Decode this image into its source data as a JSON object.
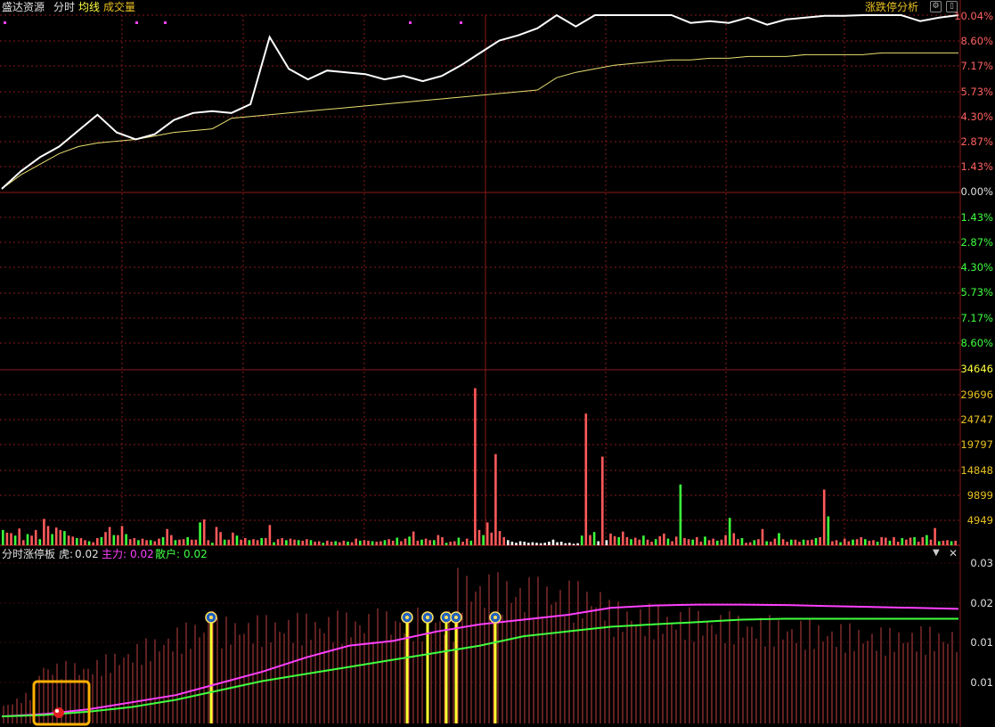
{
  "header": {
    "stock_name": "盛达资源",
    "mode": "分时",
    "avg_line_label": "均线",
    "volume_label": "成交量",
    "analysis_button": "涨跌停分析"
  },
  "indicator_header": {
    "name": "分时涨停板",
    "tiger_label": "虎:",
    "tiger_value": "0.02",
    "main_label": "主力:",
    "main_value": "0.02",
    "retail_label": "散户:",
    "retail_value": "0.02"
  },
  "price_axis": {
    "up": [
      "10.04%",
      "8.60%",
      "7.17%",
      "5.73%",
      "4.30%",
      "2.87%",
      "1.43%"
    ],
    "zero": "0.00%",
    "down": [
      "1.43%",
      "2.87%",
      "4.30%",
      "5.73%",
      "7.17%",
      "8.60%"
    ]
  },
  "volume_axis": [
    "34646",
    "29696",
    "24747",
    "19797",
    "14848",
    "9899",
    "4949"
  ],
  "indicator_axis": [
    "0.03",
    "0.02",
    "0.01",
    "0.01"
  ],
  "colors": {
    "up": "#ff5a5a",
    "down": "#3cff3c",
    "price_line": "#ffffff",
    "avg_line": "#e8e070",
    "grid": "#8a1a1a",
    "main_line": "#ff40ff",
    "retail_line": "#40ff40",
    "signal_bar": "#ffff30",
    "highlight_box": "#ffb000"
  },
  "icons": {
    "settings": "gear-icon",
    "window": "window-icon",
    "dropdown": "chevron-down-icon",
    "close": "close-icon",
    "signal_marker": "coin-icon",
    "buy_marker": "ball-icon"
  },
  "chart_data": [
    {
      "type": "line",
      "series": [
        {
          "values": [
            0.2,
            1.2,
            2.0,
            2.6,
            3.5,
            4.4,
            3.4,
            3.0,
            3.3,
            4.1,
            4.5,
            4.6,
            4.5,
            5.0,
            8.8,
            7.0,
            6.4,
            6.9,
            6.8,
            6.7,
            6.4,
            6.6,
            6.3,
            6.6,
            7.2,
            7.9,
            8.6,
            8.9,
            9.3,
            10.04,
            9.4,
            10.04,
            10.04,
            10.04,
            10.04,
            10.04,
            9.6,
            9.7,
            9.6,
            9.9,
            9.5,
            9.8,
            9.9,
            10.0,
            10.0,
            10.04,
            10.04,
            10.04,
            9.7,
            9.9,
            10.04
          ]
        },
        {
          "values": [
            0.2,
            1.0,
            1.6,
            2.2,
            2.6,
            2.8,
            2.9,
            3.0,
            3.2,
            3.4,
            3.5,
            3.6,
            4.2,
            4.3,
            4.4,
            4.5,
            4.6,
            4.7,
            4.8,
            4.9,
            5.0,
            5.1,
            5.2,
            5.3,
            5.4,
            5.5,
            5.6,
            5.7,
            5.8,
            6.5,
            6.8,
            7.0,
            7.2,
            7.3,
            7.4,
            7.5,
            7.5,
            7.6,
            7.6,
            7.7,
            7.7,
            7.7,
            7.8,
            7.8,
            7.8,
            7.8,
            7.9,
            7.9,
            7.9,
            7.9,
            7.9
          ]
        }
      ],
      "ylim": [
        -10.04,
        10.04
      ]
    },
    {
      "type": "bar",
      "values": [
        3000,
        2500,
        2400,
        1900,
        3300,
        1000,
        2200,
        1900,
        3000,
        1200,
        5200,
        3800,
        2200,
        3500,
        3000,
        2800,
        1900,
        1700,
        1400,
        1400,
        1000,
        800,
        600,
        1400,
        1600,
        2600,
        3600,
        2000,
        2000,
        3800,
        2200,
        1200,
        1400,
        1000,
        1300,
        1000,
        1000,
        800,
        1300,
        1600,
        3200,
        2000,
        1000,
        1100,
        1200,
        1600,
        1100,
        1100,
        4500,
        5100,
        1000,
        500,
        3600,
        2600,
        1100,
        1100,
        2500,
        1900,
        1100,
        1400,
        1000,
        1200,
        1000,
        1400,
        1400,
        4000,
        600,
        1200,
        1400,
        1000,
        1300,
        1100,
        1000,
        900,
        1200,
        1000,
        700,
        800,
        500,
        900,
        700,
        800,
        600,
        900,
        700,
        600,
        1300,
        900,
        1000,
        900,
        800,
        700,
        800,
        1000,
        1200,
        900,
        1500,
        800,
        1300,
        1700,
        2700,
        900,
        1100,
        1300,
        1000,
        1000,
        2000,
        1600,
        500,
        700,
        800,
        1500,
        700,
        1300,
        900,
        31000,
        3000,
        2000,
        4500,
        2500,
        18000,
        2800,
        1600,
        1000,
        700,
        500,
        800,
        700,
        500,
        600,
        500,
        400,
        500,
        700,
        1100,
        600,
        700,
        400,
        500,
        300,
        400,
        1900,
        26000,
        2000,
        2600,
        800,
        17500,
        1000,
        2300,
        1800,
        1600,
        2700,
        1600,
        1200,
        1500,
        1100,
        1900,
        1100,
        700,
        1200,
        1800,
        2300,
        1300,
        800,
        1700,
        12000,
        1400,
        1200,
        1100,
        1600,
        700,
        1700,
        1000,
        1300,
        900,
        1100,
        2000,
        5400,
        2400,
        1200,
        1400,
        500,
        600,
        1000,
        1200,
        3200,
        800,
        700,
        1300,
        2400,
        1200,
        700,
        1100,
        1100,
        700,
        1100,
        1000,
        1100,
        1400,
        1600,
        11000,
        5700,
        800,
        1000,
        600,
        1300,
        800,
        1100,
        1200,
        1600,
        1200,
        900,
        1000,
        700,
        1600,
        1500,
        900,
        1600,
        700,
        1400,
        1100,
        1500,
        1600,
        700,
        1600,
        2000,
        1100,
        3400,
        800,
        900,
        1000,
        800,
        900
      ],
      "ylim": [
        0,
        34646
      ]
    },
    {
      "type": "line",
      "series": [
        {
          "name": "主力",
          "values": [
            0.0015,
            0.002,
            0.003,
            0.0045,
            0.006,
            0.0085,
            0.011,
            0.014,
            0.0165,
            0.0175,
            0.0195,
            0.021,
            0.022,
            0.023,
            0.0245,
            0.025,
            0.0252,
            0.0252,
            0.0251,
            0.0249,
            0.0247,
            0.0245,
            0.0243
          ]
        },
        {
          "name": "散户",
          "values": [
            0.0015,
            0.0018,
            0.0025,
            0.0035,
            0.005,
            0.007,
            0.009,
            0.0105,
            0.012,
            0.0135,
            0.015,
            0.0165,
            0.0185,
            0.0195,
            0.0205,
            0.021,
            0.0215,
            0.022,
            0.0222,
            0.0222,
            0.0222,
            0.0222,
            0.0222
          ]
        }
      ],
      "ylim": [
        0,
        0.034
      ]
    }
  ]
}
